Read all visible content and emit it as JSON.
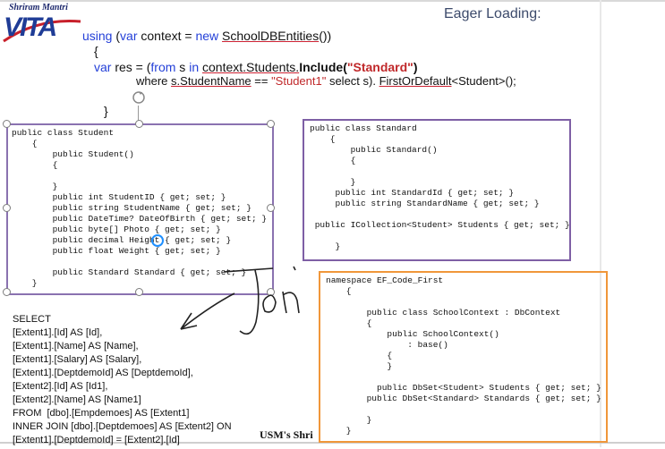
{
  "logo": {
    "name": "Shriram Mantri",
    "letters": "VITA"
  },
  "title": "Eager Loading:",
  "main_code": {
    "line1": {
      "kw1": "using",
      "p1": " (",
      "kw2": "var",
      "p2": " context = ",
      "kw3": "new",
      "p3": " ",
      "cls": "SchoolDBEntities",
      "p4": "())"
    },
    "line2": "{",
    "line3": {
      "kw1": "var",
      "p1": " res = (",
      "kw2": "from",
      "p2": " s ",
      "kw3": "in",
      "p3": " ",
      "ctx": "context.Students.",
      "inc": "Include(",
      "str": "\"Standard\"",
      "close": ")"
    },
    "line4": {
      "p1": "where ",
      "prop": "s.StudentName",
      "p2": " == ",
      "str": "\"Student1\"",
      "p3": "   select  s). ",
      "m": "FirstOrDefault",
      "p4": "<Student>();"
    },
    "line5": "}"
  },
  "student_class": {
    "lines": [
      "public class Student",
      "    {",
      "        public Student()",
      "        {",
      "",
      "        }",
      "        public int StudentID { get; set; }",
      "        public string StudentName { get; set; }",
      "        public DateTime? DateOfBirth { get; set; }",
      "        public byte[] Photo { get; set; }",
      "        public decimal Height { get; set; }",
      "        public float Weight { get; set; }",
      "",
      "        public Standard Standard { get; set; }",
      "    }"
    ]
  },
  "standard_class": {
    "lines": [
      "public class Standard",
      "    {",
      "        public Standard()",
      "        {",
      "",
      "        }",
      "     public int StandardId { get; set; }",
      "     public string StandardName { get; set; }",
      "",
      " public ICollection<Student> Students { get; set; }",
      "",
      "     }"
    ]
  },
  "namespace_block": {
    "lines": [
      "namespace EF_Code_First",
      "    {",
      "",
      "        public class SchoolContext : DbContext",
      "        {",
      "            public SchoolContext()",
      "                : base()",
      "            {",
      "            }",
      "",
      "          public DbSet<Student> Students { get; set; }",
      "        public DbSet<Standard> Standards { get; set; }",
      "",
      "        }",
      "    }"
    ]
  },
  "sql": {
    "lines": [
      "SELECT",
      "[Extent1].[Id] AS [Id],",
      "[Extent1].[Name] AS [Name],",
      "[Extent1].[Salary] AS [Salary],",
      "[Extent1].[DeptdemoId] AS [DeptdemoId],",
      "[Extent2].[Id] AS [Id1],",
      "[Extent2].[Name] AS [Name1]",
      "FROM  [dbo].[Empdemoes] AS [Extent1]",
      "INNER JOIN [dbo].[Deptdemoes] AS [Extent2] ON",
      "[Extent1].[DeptdemoId] = [Extent2].[Id]"
    ]
  },
  "annotation": "Join",
  "footer": "USM's Shri",
  "colors": {
    "keyword": "#2440d8",
    "string": "#c0282a",
    "student_border": "#8a72b0",
    "namespace_border": "#f0973a",
    "title": "#3c4a6b"
  }
}
